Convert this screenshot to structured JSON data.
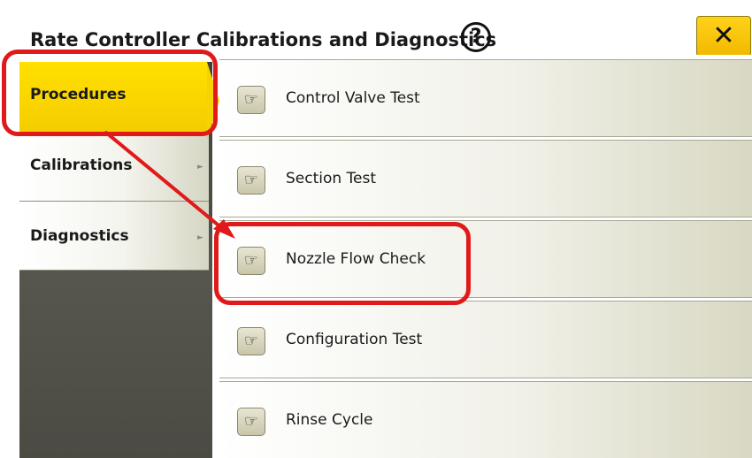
{
  "window": {
    "title": "Rate Controller Calibrations and Diagnostics",
    "help_label": "?",
    "close_label": "✕"
  },
  "nav": {
    "items": [
      {
        "label": "Procedures",
        "active": true
      },
      {
        "label": "Calibrations",
        "active": false
      },
      {
        "label": "Diagnostics",
        "active": false
      }
    ]
  },
  "procedures": [
    {
      "label": "Control Valve Test",
      "icon": "pointing-hand-icon"
    },
    {
      "label": "Section Test",
      "icon": "pointing-hand-icon"
    },
    {
      "label": "Nozzle Flow Check",
      "icon": "pointing-hand-icon"
    },
    {
      "label": "Configuration Test",
      "icon": "pointing-hand-icon"
    },
    {
      "label": "Rinse Cycle",
      "icon": "pointing-hand-icon"
    }
  ],
  "icons": {
    "pointing_hand": "☞",
    "submenu_arrow": "►"
  },
  "colors": {
    "accent_yellow": "#ffd800",
    "highlight_red": "#e01a1a",
    "nav_dark": "#4a4a42"
  }
}
